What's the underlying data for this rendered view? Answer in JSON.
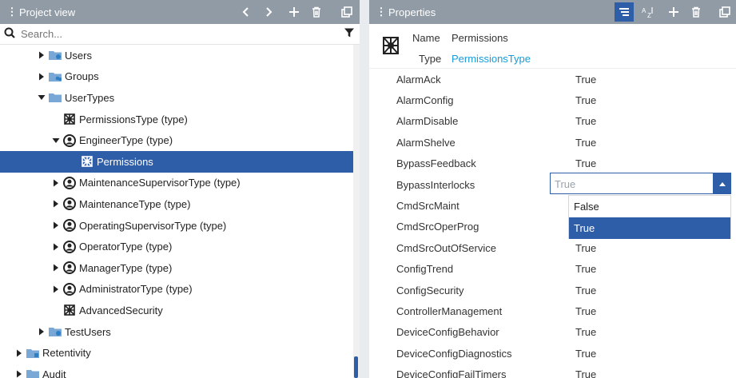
{
  "left_panel": {
    "title": "Project view",
    "search_placeholder": "Search...",
    "tree": [
      {
        "label": "Users",
        "indent": 1,
        "caret": "right",
        "icon": "users-folder-icon"
      },
      {
        "label": "Groups",
        "indent": 1,
        "caret": "right",
        "icon": "groups-folder-icon"
      },
      {
        "label": "UserTypes",
        "indent": 1,
        "caret": "down",
        "icon": "folder-icon"
      },
      {
        "label": "PermissionsType (type)",
        "indent": 2,
        "caret": "none",
        "icon": "permissions-icon"
      },
      {
        "label": "EngineerType (type)",
        "indent": 2,
        "caret": "down",
        "icon": "user-type-icon"
      },
      {
        "label": "Permissions",
        "indent": 3,
        "caret": "none",
        "icon": "permissions-icon",
        "selected": true
      },
      {
        "label": "MaintenanceSupervisorType (type)",
        "indent": 2,
        "caret": "right",
        "icon": "user-type-icon"
      },
      {
        "label": "MaintenanceType (type)",
        "indent": 2,
        "caret": "right",
        "icon": "user-type-icon"
      },
      {
        "label": "OperatingSupervisorType (type)",
        "indent": 2,
        "caret": "right",
        "icon": "user-type-icon"
      },
      {
        "label": "OperatorType (type)",
        "indent": 2,
        "caret": "right",
        "icon": "user-type-icon"
      },
      {
        "label": "ManagerType (type)",
        "indent": 2,
        "caret": "right",
        "icon": "user-type-icon"
      },
      {
        "label": "AdministratorType (type)",
        "indent": 2,
        "caret": "right",
        "icon": "user-type-icon"
      },
      {
        "label": "AdvancedSecurity",
        "indent": 2,
        "caret": "none",
        "icon": "permissions-icon"
      },
      {
        "label": "TestUsers",
        "indent": 1,
        "caret": "right",
        "icon": "users-folder-icon"
      },
      {
        "label": "Retentivity",
        "indent": 0,
        "caret": "right",
        "icon": "retentivity-folder-icon"
      },
      {
        "label": "Audit",
        "indent": 0,
        "caret": "right",
        "icon": "folder-icon"
      }
    ]
  },
  "right_panel": {
    "title": "Properties",
    "name_key": "Name",
    "name_value": "Permissions",
    "type_key": "Type",
    "type_value": "PermissionsType",
    "properties": [
      {
        "name": "AlarmAck",
        "value": "True"
      },
      {
        "name": "AlarmConfig",
        "value": "True"
      },
      {
        "name": "AlarmDisable",
        "value": "True"
      },
      {
        "name": "AlarmShelve",
        "value": "True"
      },
      {
        "name": "BypassFeedback",
        "value": "True"
      },
      {
        "name": "BypassInterlocks",
        "value": ""
      },
      {
        "name": "CmdSrcMaint",
        "value": ""
      },
      {
        "name": "CmdSrcOperProg",
        "value": ""
      },
      {
        "name": "CmdSrcOutOfService",
        "value": "True"
      },
      {
        "name": "ConfigTrend",
        "value": "True"
      },
      {
        "name": "ConfigSecurity",
        "value": "True"
      },
      {
        "name": "ControllerManagement",
        "value": "True"
      },
      {
        "name": "DeviceConfigBehavior",
        "value": "True"
      },
      {
        "name": "DeviceConfigDiagnostics",
        "value": "True"
      },
      {
        "name": "DeviceConfigFailTimers",
        "value": "True"
      }
    ],
    "dropdown": {
      "current": "True",
      "options": [
        "False",
        "True"
      ],
      "selected_option": "True"
    }
  },
  "colors": {
    "header_bg": "#919ba6",
    "selection": "#2f5ea8",
    "link": "#1a9ad6"
  }
}
